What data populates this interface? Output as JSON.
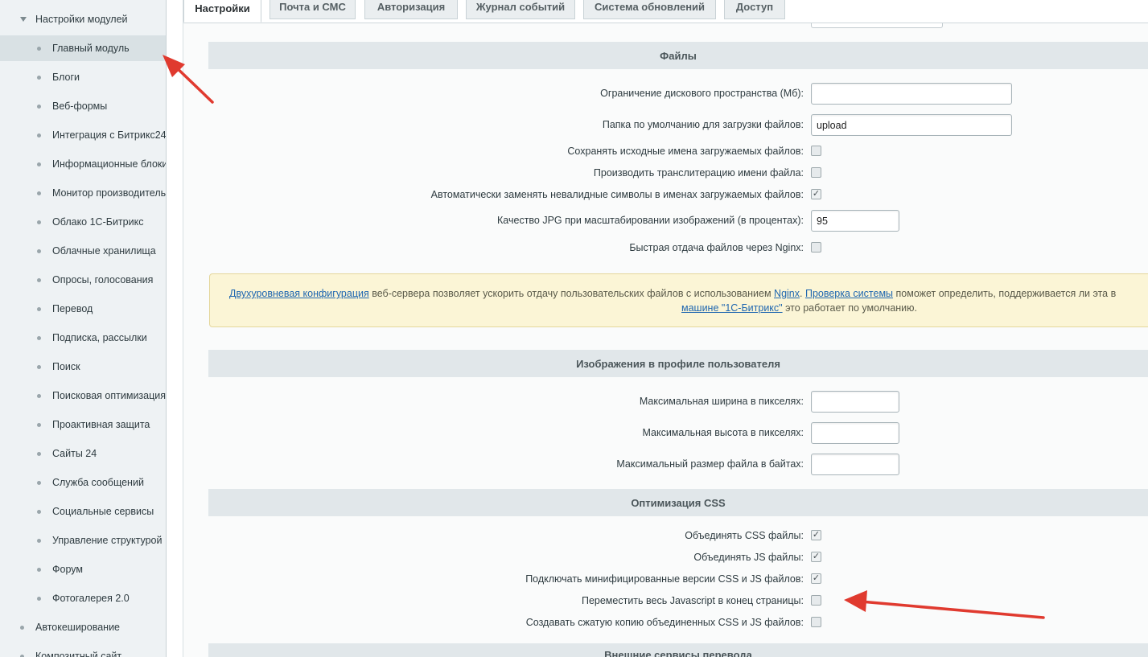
{
  "sidebar": {
    "group_title": "Настройки модулей",
    "items": [
      {
        "label": "Главный модуль",
        "active": true
      },
      {
        "label": "Блоги"
      },
      {
        "label": "Веб-формы"
      },
      {
        "label": "Интеграция с Битрикс24"
      },
      {
        "label": "Информационные блоки"
      },
      {
        "label": "Монитор производительности"
      },
      {
        "label": "Облако 1С-Битрикс"
      },
      {
        "label": "Облачные хранилища"
      },
      {
        "label": "Опросы, голосования"
      },
      {
        "label": "Перевод"
      },
      {
        "label": "Подписка, рассылки"
      },
      {
        "label": "Поиск"
      },
      {
        "label": "Поисковая оптимизация"
      },
      {
        "label": "Проактивная защита"
      },
      {
        "label": "Сайты 24"
      },
      {
        "label": "Служба сообщений"
      },
      {
        "label": "Социальные сервисы"
      },
      {
        "label": "Управление структурой"
      },
      {
        "label": "Форум"
      },
      {
        "label": "Фотогалерея 2.0"
      }
    ],
    "top_items": [
      {
        "label": "Автокеширование"
      },
      {
        "label": "Композитный сайт"
      }
    ]
  },
  "tabs": [
    {
      "label": "Настройки",
      "active": true
    },
    {
      "label": "Почта и СМС"
    },
    {
      "label": "Авторизация"
    },
    {
      "label": "Журнал событий"
    },
    {
      "label": "Система обновлений"
    },
    {
      "label": "Доступ"
    }
  ],
  "files_section": {
    "title": "Файлы",
    "disk_limit_label": "Ограничение дискового пространства (Мб):",
    "disk_limit_value": "",
    "upload_dir_label": "Папка по умолчанию для загрузки файлов:",
    "upload_dir_value": "upload",
    "save_names_label": "Сохранять исходные имена загружаемых файлов:",
    "save_names_checked": false,
    "translit_label": "Производить транслитерацию имени файла:",
    "translit_checked": false,
    "replace_invalid_label": "Автоматически заменять невалидные символы в именах загружаемых файлов:",
    "replace_invalid_checked": true,
    "jpg_quality_label": "Качество JPG при масштабировании изображений (в процентах):",
    "jpg_quality_value": "95",
    "nginx_label": "Быстрая отдача файлов через Nginx:",
    "nginx_checked": false
  },
  "notice": {
    "link1": "Двухуровневая конфигурация",
    "text1": " веб-сервера позволяет ускорить отдачу пользовательских файлов с использованием ",
    "link2": "Nginx",
    "text2": ". ",
    "link3": "Проверка системы",
    "text3": " поможет определить, поддерживается ли эта в",
    "link4": "машине \"1С-Битрикс\"",
    "text4": " это работает по умолчанию."
  },
  "avatar_section": {
    "title": "Изображения в профиле пользователя",
    "max_width_label": "Максимальная ширина в пикселях:",
    "max_width_value": "",
    "max_height_label": "Максимальная высота в пикселях:",
    "max_height_value": "",
    "max_size_label": "Максимальный размер файла в байтах:",
    "max_size_value": ""
  },
  "css_section": {
    "title": "Оптимизация CSS",
    "merge_css_label": "Объединять CSS файлы:",
    "merge_css_checked": true,
    "merge_js_label": "Объединять JS файлы:",
    "merge_js_checked": true,
    "minified_label": "Подключать минифицированные версии CSS и JS файлов:",
    "minified_checked": true,
    "move_js_label": "Переместить весь Javascript в конец страницы:",
    "move_js_checked": false,
    "compress_label": "Создавать сжатую копию объединенных CSS и JS файлов:",
    "compress_checked": false
  },
  "next_section": {
    "title": "Внешние сервисы перевода"
  },
  "colors": {
    "annotation_arrow": "#e03a2f",
    "link": "#2067b0",
    "notice_bg": "#fbf5d6"
  }
}
